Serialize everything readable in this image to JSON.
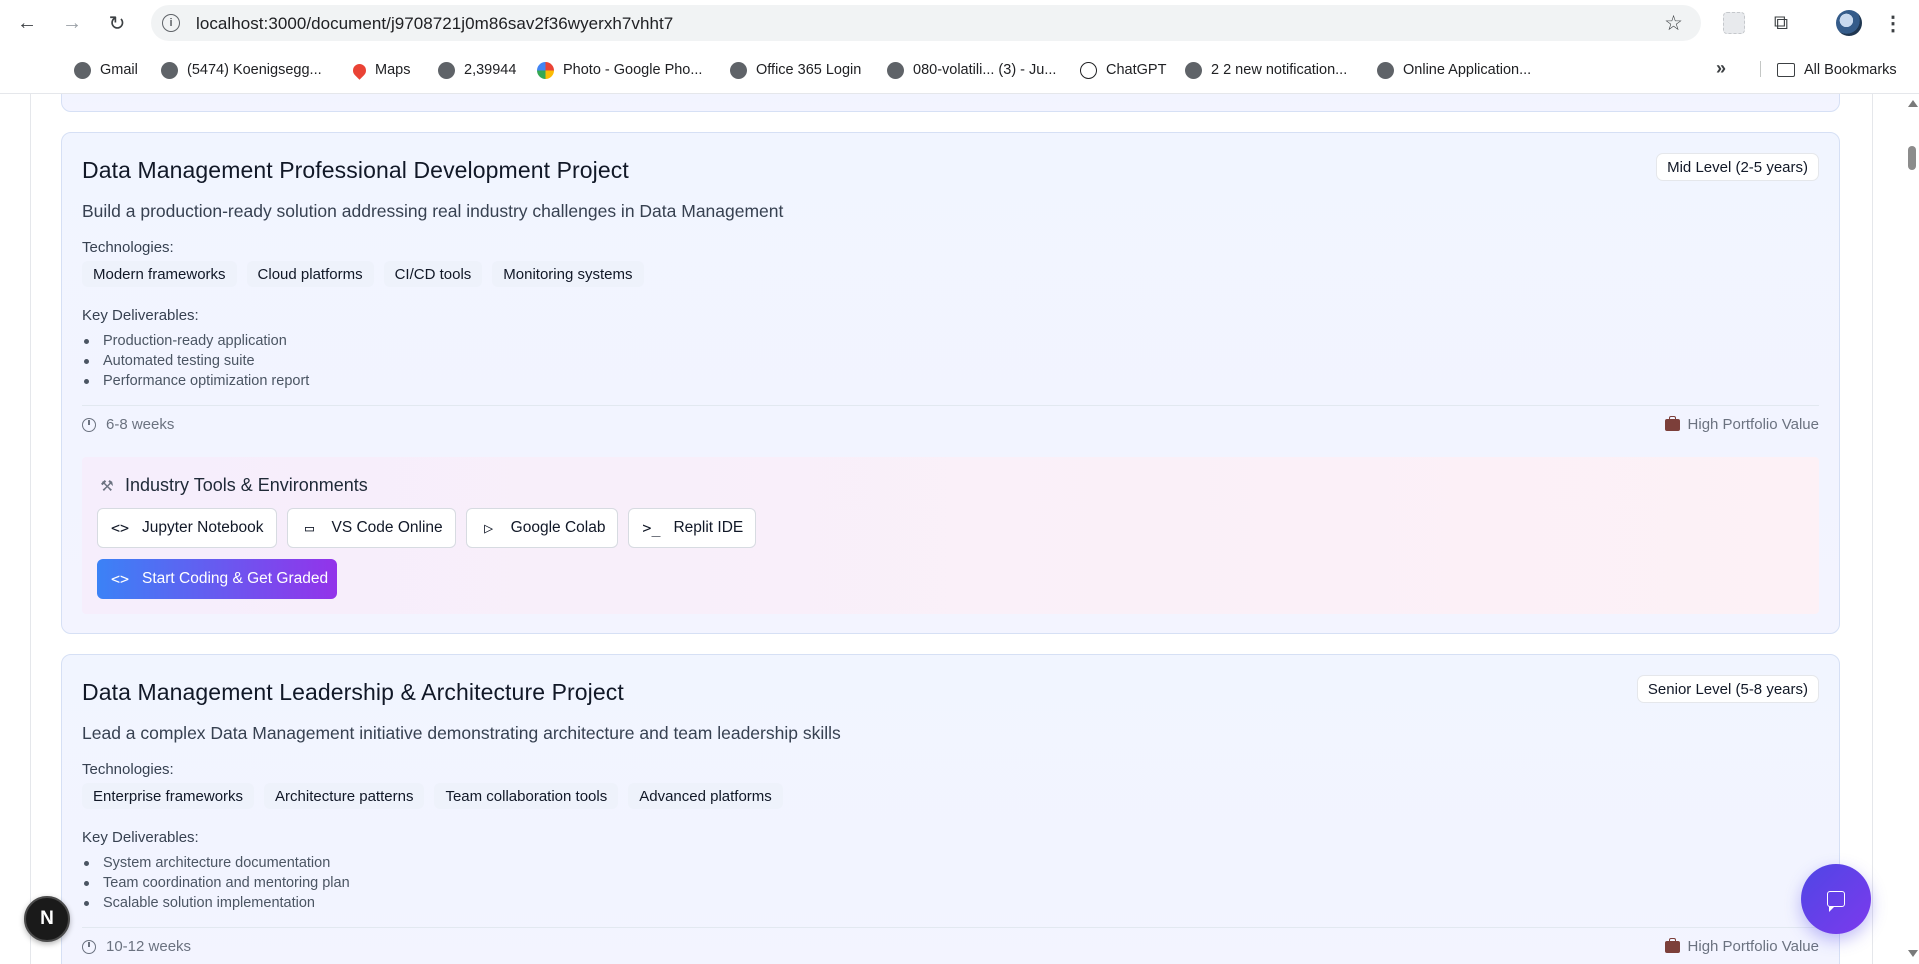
{
  "browser": {
    "url": "localhost:3000/document/j9708721j0m86sav2f36wyerxh7vhht7",
    "bookmarks": [
      {
        "label": "Gmail",
        "icon": "gmail-icon"
      },
      {
        "label": "(5474) Koenigsegg...",
        "icon": "globe-icon"
      },
      {
        "label": "Maps",
        "icon": "maps-icon"
      },
      {
        "label": "2,39944",
        "icon": "globe-icon"
      },
      {
        "label": "Photo - Google Pho...",
        "icon": "photos-icon"
      },
      {
        "label": "Office 365 Login",
        "icon": "globe-icon"
      },
      {
        "label": "080-volatili... (3) - Ju...",
        "icon": "globe-icon"
      },
      {
        "label": "ChatGPT",
        "icon": "chatgpt-icon"
      },
      {
        "label": "2 2 new notification...",
        "icon": "globe-icon"
      },
      {
        "label": "Online Application...",
        "icon": "globe-icon"
      }
    ],
    "all_bookmarks": "All Bookmarks",
    "more_glyph": "»"
  },
  "projects": [
    {
      "title": "Data Management Professional Development Project",
      "level": "Mid Level (2-5 years)",
      "description": "Build a production-ready solution addressing real industry challenges in Data Management",
      "technologies_label": "Technologies:",
      "technologies": [
        "Modern frameworks",
        "Cloud platforms",
        "CI/CD tools",
        "Monitoring systems"
      ],
      "deliverables_label": "Key Deliverables:",
      "deliverables": [
        "Production-ready application",
        "Automated testing suite",
        "Performance optimization report"
      ],
      "duration": "6-8 weeks",
      "portfolio": "High Portfolio Value",
      "tools_title": "Industry Tools & Environments",
      "tools": [
        {
          "label": "Jupyter Notebook",
          "glyph": "<>"
        },
        {
          "label": "VS Code Online",
          "glyph": "▭"
        },
        {
          "label": "Google Colab",
          "glyph": "▷"
        },
        {
          "label": "Replit IDE",
          "glyph": ">_"
        }
      ],
      "start_label": "Start Coding & Get Graded",
      "start_glyph": "<>"
    },
    {
      "title": "Data Management Leadership & Architecture Project",
      "level": "Senior Level (5-8 years)",
      "description": "Lead a complex Data Management initiative demonstrating architecture and team leadership skills",
      "technologies_label": "Technologies:",
      "technologies": [
        "Enterprise frameworks",
        "Architecture patterns",
        "Team collaboration tools",
        "Advanced platforms"
      ],
      "deliverables_label": "Key Deliverables:",
      "deliverables": [
        "System architecture documentation",
        "Team coordination and mentoring plan",
        "Scalable solution implementation"
      ],
      "duration": "10-12 weeks",
      "portfolio": "High Portfolio Value"
    }
  ],
  "floating": {
    "next_badge": "N"
  },
  "colors": {
    "accent_start": "#3b82f6",
    "accent_end": "#9333ea",
    "chat_fab": "#4f46e5"
  }
}
